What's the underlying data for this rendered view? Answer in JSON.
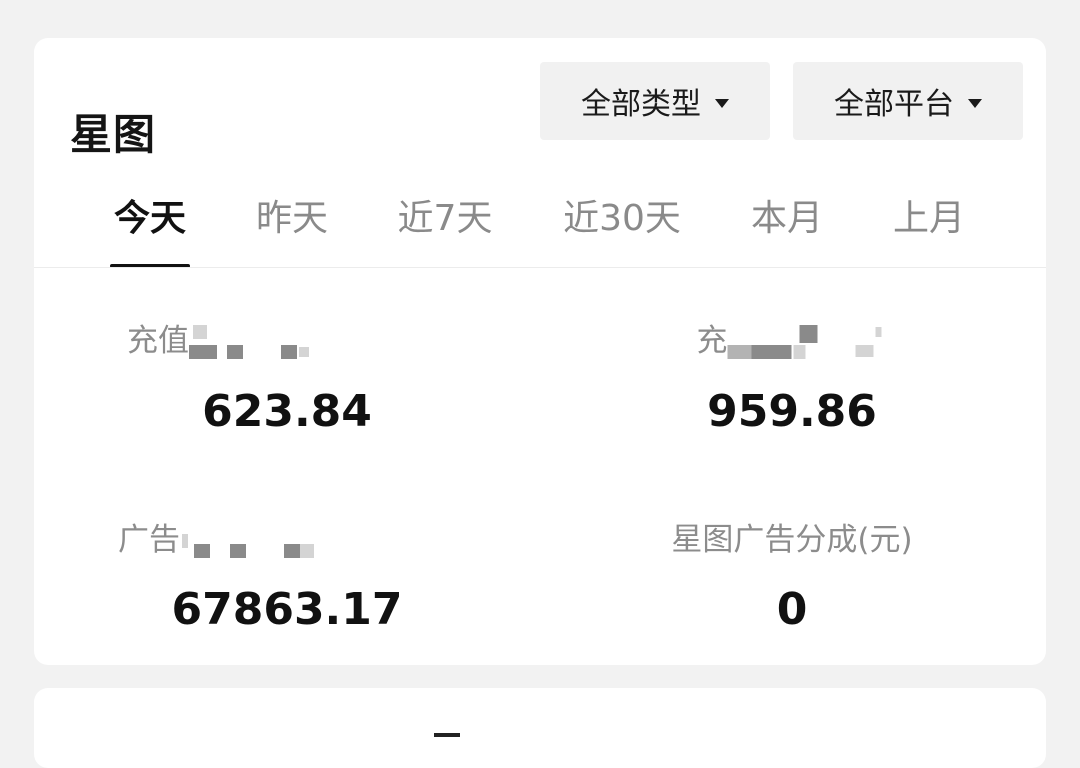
{
  "header": {
    "title": "星图",
    "filters": [
      {
        "label": "全部类型"
      },
      {
        "label": "全部平台"
      }
    ]
  },
  "tabs": [
    {
      "label": "今天",
      "active": true
    },
    {
      "label": "昨天",
      "active": false
    },
    {
      "label": "近7天",
      "active": false
    },
    {
      "label": "近30天",
      "active": false
    },
    {
      "label": "本月",
      "active": false
    },
    {
      "label": "上月",
      "active": false
    }
  ],
  "stats": [
    {
      "label": "充值",
      "value": "623.84"
    },
    {
      "label": "充",
      "value": "959.86"
    },
    {
      "label": "广告",
      "value": "67863.17"
    },
    {
      "label": "星图广告分成(元)",
      "value": "0"
    }
  ],
  "colors": {
    "background": "#f2f2f2",
    "card": "#ffffff",
    "text_primary": "#111111",
    "text_secondary": "#8a8a8a",
    "filter_bg": "#f1f1f1"
  }
}
